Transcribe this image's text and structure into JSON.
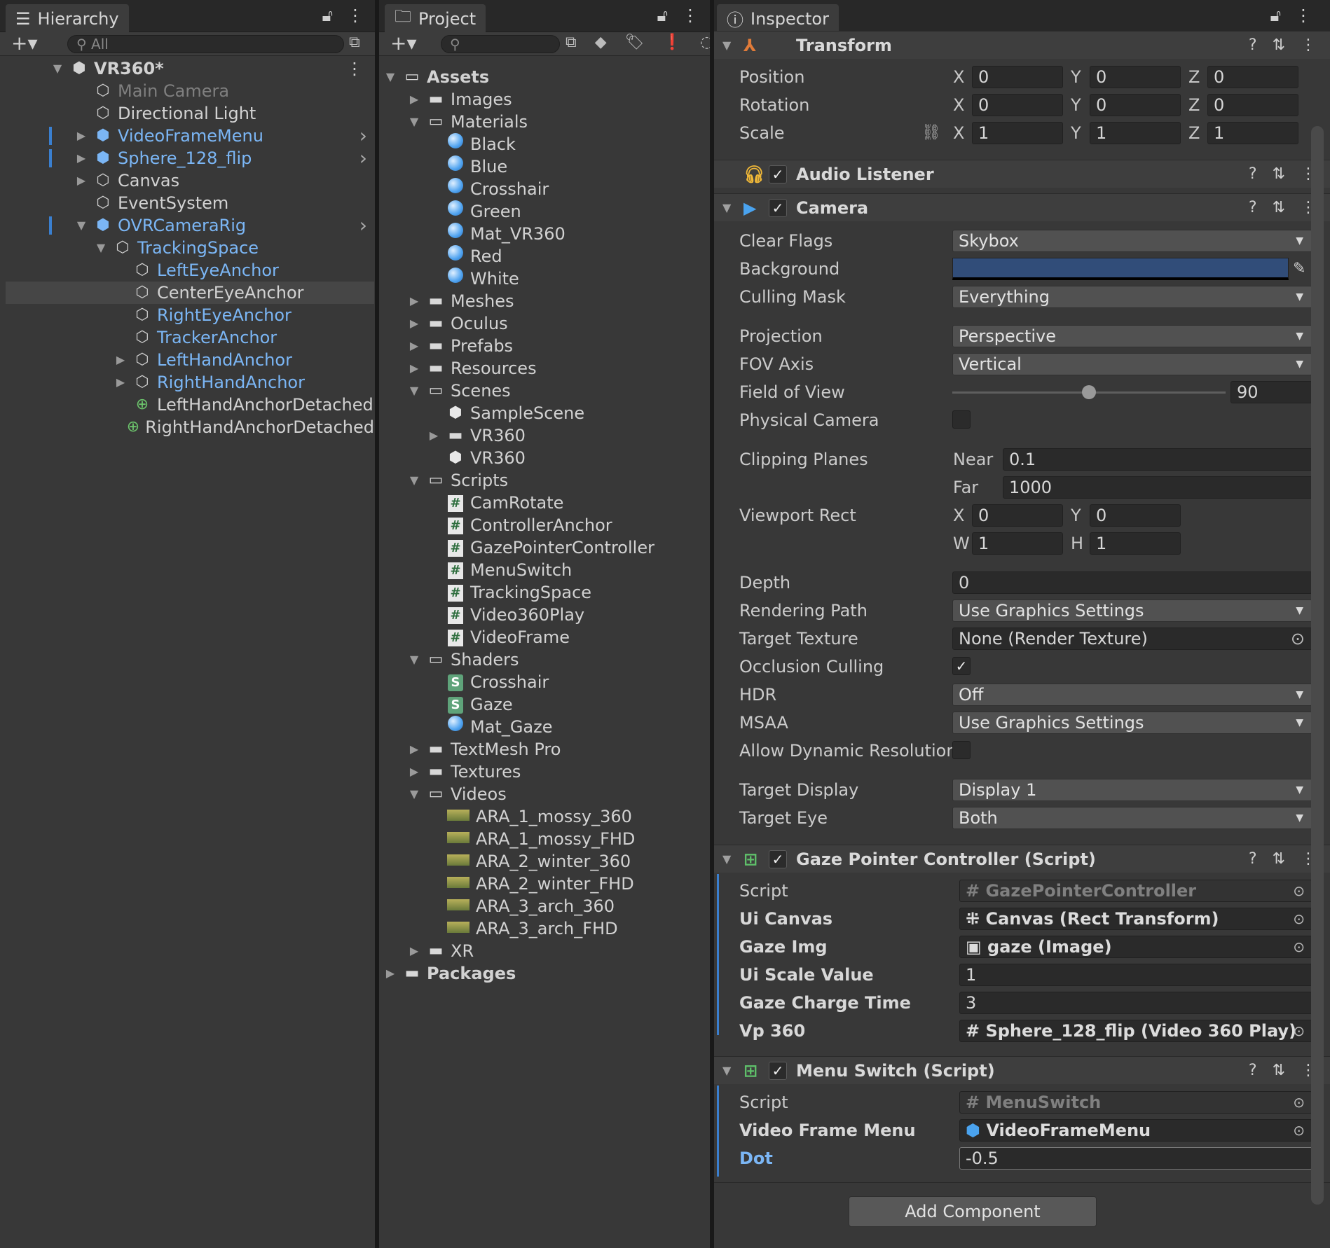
{
  "hierarchy": {
    "tab": "Hierarchy",
    "search_placeholder": "All",
    "root": "VR360*",
    "items": [
      {
        "label": "Main Camera",
        "style": "dim"
      },
      {
        "label": "Directional Light",
        "style": ""
      },
      {
        "label": "VideoFrameMenu",
        "style": "blue"
      },
      {
        "label": "Sphere_128_flip",
        "style": "blue"
      },
      {
        "label": "Canvas",
        "style": ""
      },
      {
        "label": "EventSystem",
        "style": ""
      },
      {
        "label": "OVRCameraRig",
        "style": "blue"
      },
      {
        "label": "TrackingSpace",
        "style": "blue"
      },
      {
        "label": "LeftEyeAnchor",
        "style": "blue"
      },
      {
        "label": "CenterEyeAnchor",
        "style": "sel"
      },
      {
        "label": "RightEyeAnchor",
        "style": "blue"
      },
      {
        "label": "TrackerAnchor",
        "style": "blue"
      },
      {
        "label": "LeftHandAnchor",
        "style": "blue"
      },
      {
        "label": "RightHandAnchor",
        "style": "blue"
      },
      {
        "label": "LeftHandAnchorDetached",
        "style": ""
      },
      {
        "label": "RightHandAnchorDetached",
        "style": ""
      }
    ]
  },
  "project": {
    "tab": "Project",
    "hidden_count": "1",
    "items": [
      {
        "label": "Assets",
        "icon": "folder-open"
      },
      {
        "label": "Images",
        "icon": "folder"
      },
      {
        "label": "Materials",
        "icon": "folder-open"
      },
      {
        "label": "Black",
        "icon": "material"
      },
      {
        "label": "Blue",
        "icon": "material"
      },
      {
        "label": "Crosshair",
        "icon": "material"
      },
      {
        "label": "Green",
        "icon": "material"
      },
      {
        "label": "Mat_VR360",
        "icon": "material"
      },
      {
        "label": "Red",
        "icon": "material"
      },
      {
        "label": "White",
        "icon": "material"
      },
      {
        "label": "Meshes",
        "icon": "folder"
      },
      {
        "label": "Oculus",
        "icon": "folder"
      },
      {
        "label": "Prefabs",
        "icon": "folder"
      },
      {
        "label": "Resources",
        "icon": "folder"
      },
      {
        "label": "Scenes",
        "icon": "folder-open"
      },
      {
        "label": "SampleScene",
        "icon": "scene"
      },
      {
        "label": "VR360",
        "icon": "folder"
      },
      {
        "label": "VR360",
        "icon": "scene"
      },
      {
        "label": "Scripts",
        "icon": "folder-open"
      },
      {
        "label": "CamRotate",
        "icon": "script"
      },
      {
        "label": "ControllerAnchor",
        "icon": "script"
      },
      {
        "label": "GazePointerController",
        "icon": "script"
      },
      {
        "label": "MenuSwitch",
        "icon": "script"
      },
      {
        "label": "TrackingSpace",
        "icon": "script"
      },
      {
        "label": "Video360Play",
        "icon": "script"
      },
      {
        "label": "VideoFrame",
        "icon": "script"
      },
      {
        "label": "Shaders",
        "icon": "folder-open"
      },
      {
        "label": "Crosshair",
        "icon": "shader"
      },
      {
        "label": "Gaze",
        "icon": "shader"
      },
      {
        "label": "Mat_Gaze",
        "icon": "material"
      },
      {
        "label": "TextMesh Pro",
        "icon": "folder"
      },
      {
        "label": "Textures",
        "icon": "folder"
      },
      {
        "label": "Videos",
        "icon": "folder-open"
      },
      {
        "label": "ARA_1_mossy_360",
        "icon": "video"
      },
      {
        "label": "ARA_1_mossy_FHD",
        "icon": "video"
      },
      {
        "label": "ARA_2_winter_360",
        "icon": "video"
      },
      {
        "label": "ARA_2_winter_FHD",
        "icon": "video"
      },
      {
        "label": "ARA_3_arch_360",
        "icon": "video"
      },
      {
        "label": "ARA_3_arch_FHD",
        "icon": "video"
      },
      {
        "label": "XR",
        "icon": "folder"
      },
      {
        "label": "Packages",
        "icon": "folder"
      }
    ]
  },
  "inspector": {
    "tab": "Inspector",
    "transform": {
      "title": "Transform",
      "position_label": "Position",
      "rotation_label": "Rotation",
      "scale_label": "Scale",
      "x": "X",
      "y": "Y",
      "z": "Z",
      "position": [
        "0",
        "0",
        "0"
      ],
      "rotation": [
        "0",
        "0",
        "0"
      ],
      "scale": [
        "1",
        "1",
        "1"
      ]
    },
    "audio_listener": {
      "title": "Audio Listener"
    },
    "camera": {
      "title": "Camera",
      "clear_flags_label": "Clear Flags",
      "clear_flags": "Skybox",
      "background_label": "Background",
      "background_color": "#314d79",
      "culling_mask_label": "Culling Mask",
      "culling_mask": "Everything",
      "projection_label": "Projection",
      "projection": "Perspective",
      "fov_axis_label": "FOV Axis",
      "fov_axis": "Vertical",
      "fov_label": "Field of View",
      "fov": "90",
      "fov_slider_fraction": 0.5,
      "physical_label": "Physical Camera",
      "clipping_label": "Clipping Planes",
      "near_label": "Near",
      "near": "0.1",
      "far_label": "Far",
      "far": "1000",
      "viewport_label": "Viewport Rect",
      "vx": "0",
      "vy": "0",
      "vw": "1",
      "vh": "1",
      "w": "W",
      "h": "H",
      "depth_label": "Depth",
      "depth": "0",
      "rendering_path_label": "Rendering Path",
      "rendering_path": "Use Graphics Settings",
      "target_texture_label": "Target Texture",
      "target_texture": "None (Render Texture)",
      "occlusion_label": "Occlusion Culling",
      "hdr_label": "HDR",
      "hdr": "Off",
      "msaa_label": "MSAA",
      "msaa": "Use Graphics Settings",
      "dynres_label": "Allow Dynamic Resolution",
      "target_display_label": "Target Display",
      "target_display": "Display 1",
      "target_eye_label": "Target Eye",
      "target_eye": "Both"
    },
    "gaze": {
      "title": "Gaze Pointer Controller (Script)",
      "script_label": "Script",
      "script": "GazePointerController",
      "ui_canvas_label": "Ui Canvas",
      "ui_canvas": "Canvas (Rect Transform)",
      "gaze_img_label": "Gaze Img",
      "gaze_img": "gaze (Image)",
      "ui_scale_label": "Ui Scale Value",
      "ui_scale": "1",
      "charge_label": "Gaze Charge Time",
      "charge": "3",
      "vp_label": "Vp 360",
      "vp": "Sphere_128_flip (Video 360 Play)"
    },
    "menu": {
      "title": "Menu Switch (Script)",
      "script_label": "Script",
      "script": "MenuSwitch",
      "vfm_label": "Video Frame Menu",
      "vfm": "VideoFrameMenu",
      "dot_label": "Dot",
      "dot": "-0.5"
    },
    "add_component": "Add Component"
  }
}
